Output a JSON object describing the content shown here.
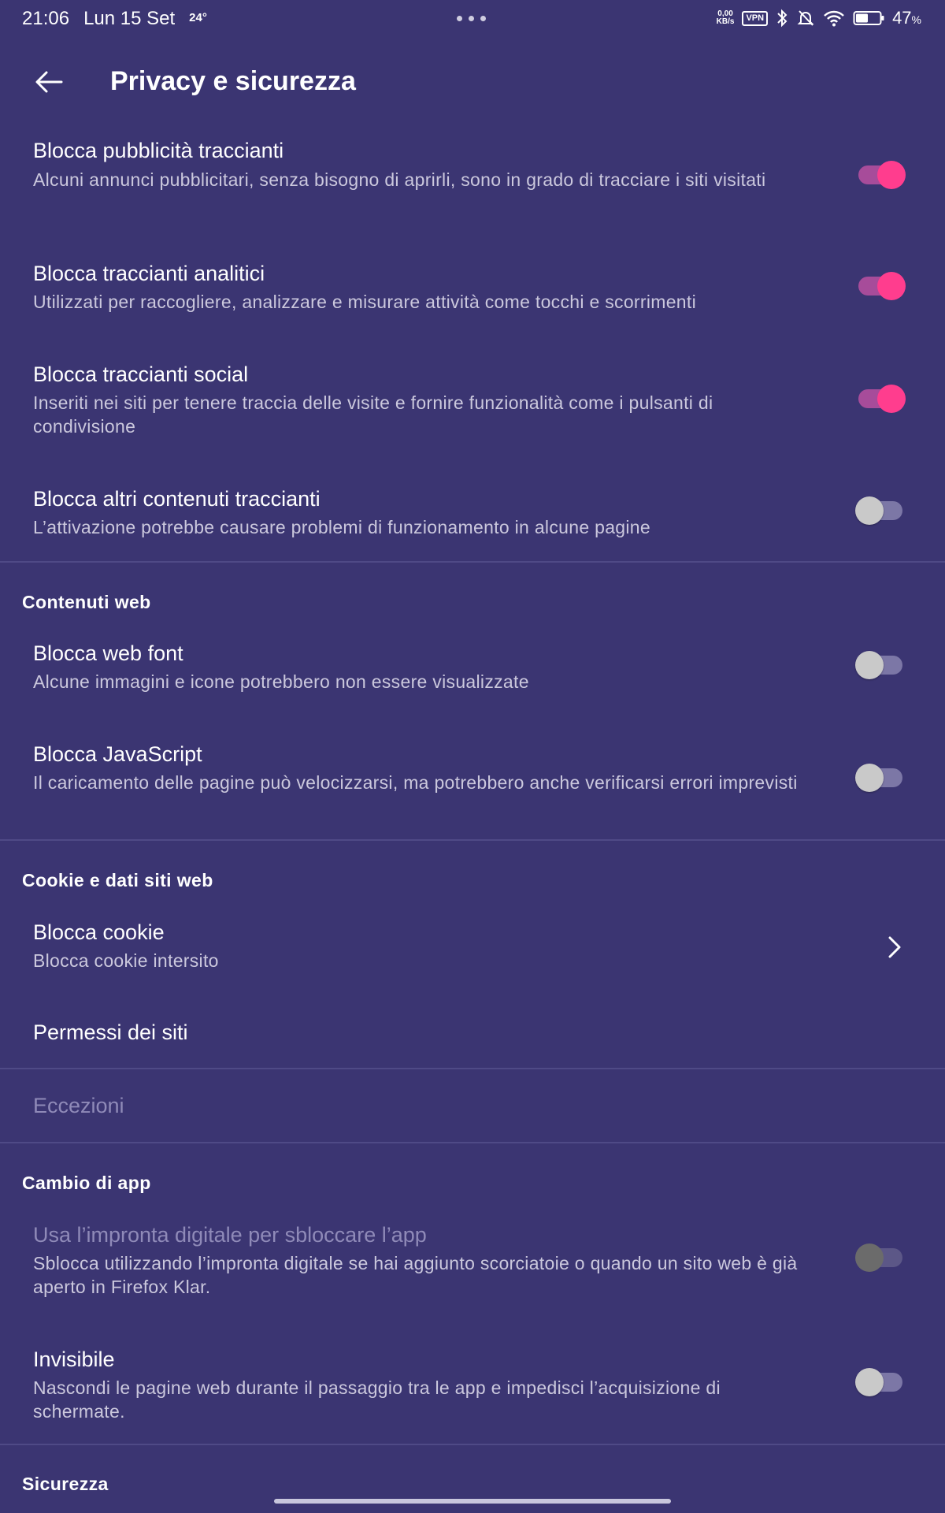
{
  "status_bar": {
    "time": "21:06",
    "date": "Lun 15 Set",
    "temperature": "24°",
    "net_speed_value": "0,00",
    "net_speed_unit": "KB/s",
    "vpn": "VPN",
    "battery_value": "47",
    "battery_unit": "%"
  },
  "appbar": {
    "title": "Privacy e sicurezza"
  },
  "tracking": [
    {
      "title": "Blocca pubblicità traccianti",
      "subtitle": "Alcuni annunci pubblicitari, senza bisogno di aprirli, sono in grado di tracciare i siti visitati",
      "enabled": true
    },
    {
      "title": "Blocca traccianti analitici",
      "subtitle": "Utilizzati per raccogliere, analizzare e misurare attività come tocchi e scorrimenti",
      "enabled": true
    },
    {
      "title": "Blocca traccianti social",
      "subtitle": "Inseriti nei siti per tenere traccia delle visite e fornire funzionalità come i pulsanti di condivisione",
      "enabled": true
    },
    {
      "title": "Blocca altri contenuti traccianti",
      "subtitle": "L’attivazione potrebbe causare problemi di funzionamento in alcune pagine",
      "enabled": false
    }
  ],
  "web_content": {
    "header": "Contenuti web",
    "items": [
      {
        "title": "Blocca web font",
        "subtitle": "Alcune immagini e icone potrebbero non essere visualizzate",
        "enabled": false
      },
      {
        "title": "Blocca JavaScript",
        "subtitle": "Il caricamento delle pagine può velocizzarsi, ma potrebbero anche verificarsi errori imprevisti",
        "enabled": false
      }
    ]
  },
  "cookies": {
    "header": "Cookie e dati siti web",
    "block_cookie": {
      "title": "Blocca cookie",
      "subtitle": "Blocca cookie intersito"
    },
    "site_permissions": "Permessi dei siti",
    "exceptions": "Eccezioni"
  },
  "app_switch": {
    "header": "Cambio di app",
    "fingerprint": {
      "title": "Usa l’impronta digitale per sbloccare l’app",
      "subtitle": "Sblocca utilizzando l’impronta digitale se hai aggiunto scorciatoie o quando un sito web è già aperto in Firefox Klar.",
      "enabled": false,
      "disabled": true
    },
    "invisible": {
      "title": "Invisibile",
      "subtitle": "Nascondi le pagine web durante il passaggio tra le app e impedisci l’acquisizione di schermate.",
      "enabled": false
    }
  },
  "security": {
    "header": "Sicurezza"
  },
  "colors": {
    "background": "#3b3572",
    "accent_on": "#ff3d8e",
    "divider": "#4f4a86"
  }
}
